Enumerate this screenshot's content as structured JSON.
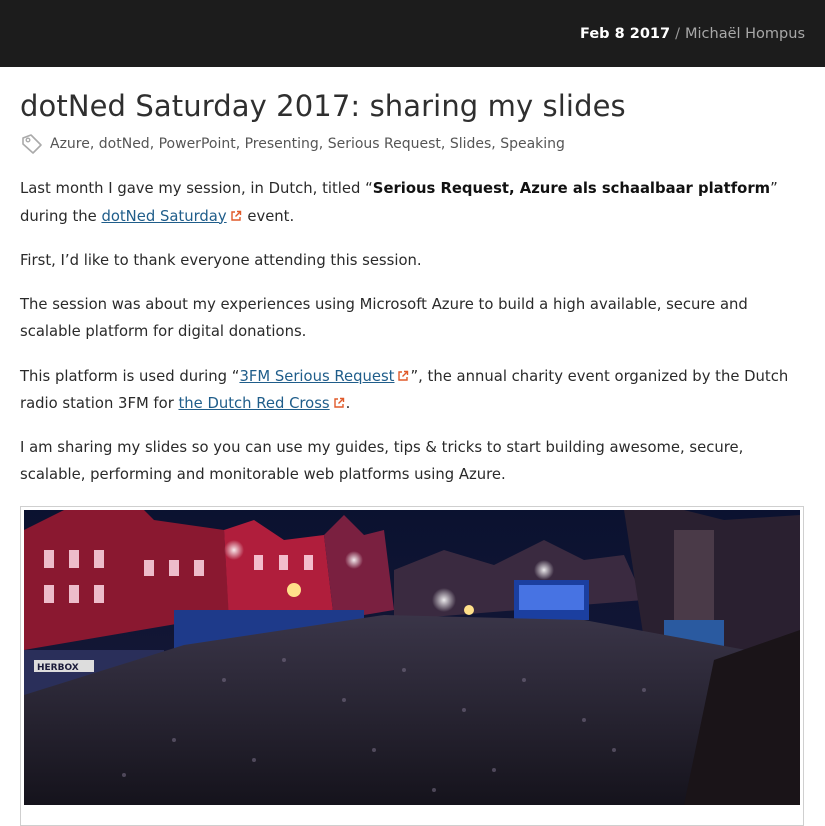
{
  "topbar": {
    "date": "Feb 8 2017",
    "separator": "/",
    "author": "Michaël Hompus"
  },
  "post": {
    "title": "dotNed Saturday 2017: sharing my slides",
    "tags": [
      "Azure",
      "dotNed",
      "PowerPoint",
      "Presenting",
      "Serious Request",
      "Slides",
      "Speaking"
    ],
    "p1": {
      "before": "Last month I gave my session, in Dutch, titled “",
      "bold": "Serious Request, Azure als schaalbaar platform",
      "middle": "” during the ",
      "link": "dotNed Saturday",
      "after": " event."
    },
    "p2": "First, I’d like to thank everyone attending this session.",
    "p3": "The session was about my experiences using Microsoft Azure to build a high available, secure and scalable platform for digital donations.",
    "p4": {
      "before": "This platform is used during “",
      "link1": "3FM Serious Request",
      "middle": "”, the annual charity event organized by the Dutch radio station 3FM for ",
      "link2": "the Dutch Red Cross",
      "after": "."
    },
    "p5": "I am sharing my slides so you can use my guides, tips & tricks to start building awesome, secure, scalable, performing and monitorable web platforms using Azure.",
    "image": {
      "sign_text": "HERBOX"
    }
  },
  "colors": {
    "topbar_bg": "#1c1c1c",
    "link": "#1f5d8a",
    "external_icon": "#e05a2a"
  }
}
